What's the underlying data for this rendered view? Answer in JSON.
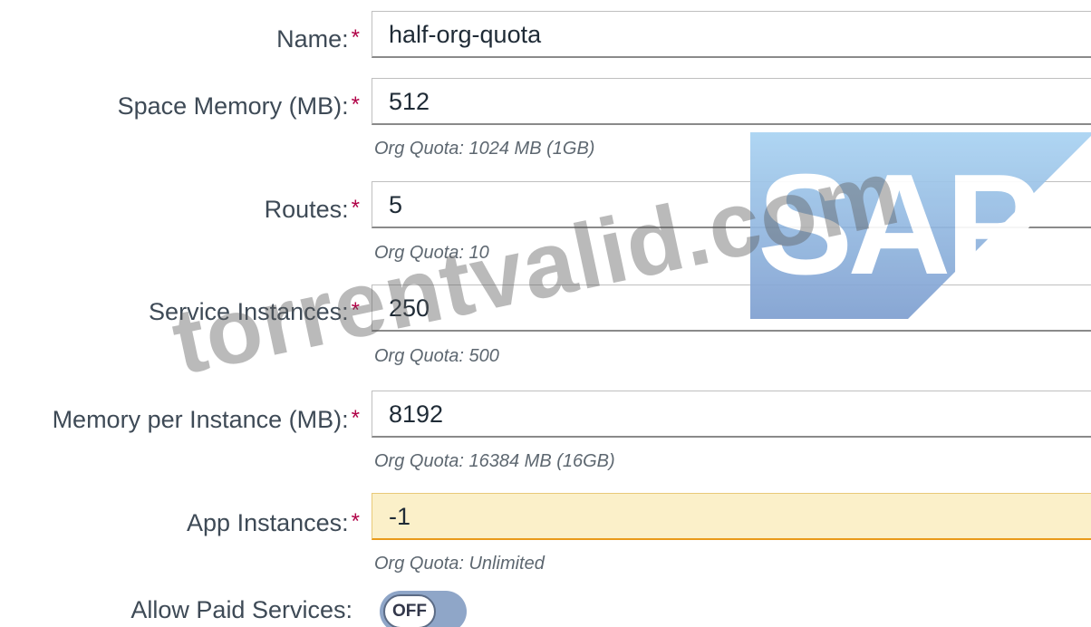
{
  "form": {
    "required_marker": "*",
    "fields": [
      {
        "label": "Name:",
        "value": "half-org-quota",
        "required": true
      },
      {
        "label": "Space Memory (MB):",
        "value": "512",
        "required": true,
        "hint": "Org Quota: 1024 MB (1GB)"
      },
      {
        "label": "Routes:",
        "value": "5",
        "required": true,
        "hint": "Org Quota: 10"
      },
      {
        "label": "Service Instances:",
        "value": "250",
        "required": true,
        "hint": "Org Quota: 500"
      },
      {
        "label": "Memory per Instance (MB):",
        "value": "8192",
        "required": true,
        "hint": "Org Quota: 16384 MB (16GB)"
      },
      {
        "label": "App Instances:",
        "value": "-1",
        "required": true,
        "hint": "Org Quota: Unlimited",
        "state": "warning"
      }
    ],
    "paid_services": {
      "label": "Allow Paid Services:",
      "toggle_text": "OFF"
    }
  },
  "logo": {
    "text": "SAP",
    "registered": "®"
  },
  "watermark": {
    "text": "torrentvalid.com"
  },
  "colors": {
    "required_star": "#b00046",
    "warning_bg": "#fbf0c9",
    "warning_border": "#e99a1a",
    "logo_blue_top": "#a9d3f2",
    "logo_blue_bottom": "#7f9fd0",
    "toggle_track": "#8fa6c8"
  }
}
